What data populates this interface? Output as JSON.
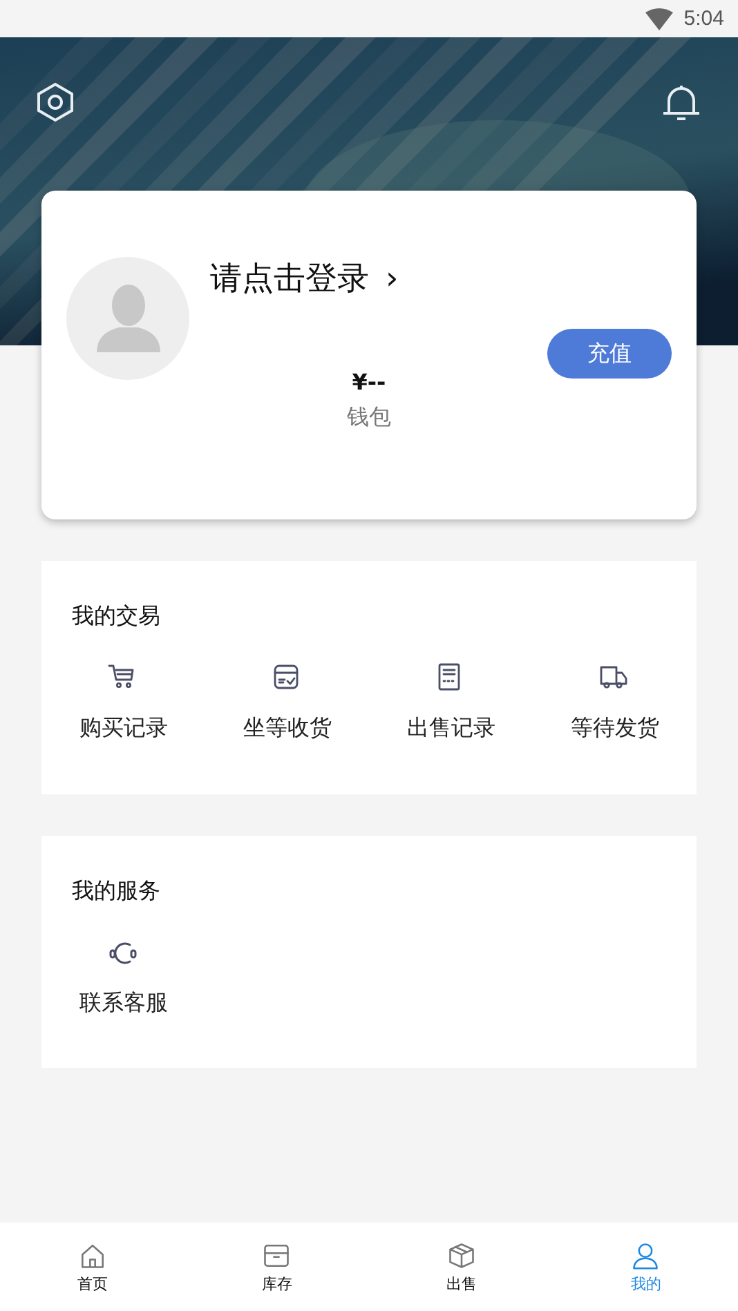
{
  "status_bar": {
    "time": "5:04"
  },
  "profile": {
    "login_prompt": "请点击登录",
    "chevron": "›",
    "recharge_button": "充值",
    "balance": "¥--",
    "balance_label": "钱包"
  },
  "trade_section": {
    "title": "我的交易",
    "items": [
      {
        "label": "购买记录"
      },
      {
        "label": "坐等收货"
      },
      {
        "label": "出售记录"
      },
      {
        "label": "等待发货"
      }
    ]
  },
  "service_section": {
    "title": "我的服务",
    "items": [
      {
        "label": "联系客服"
      }
    ]
  },
  "tab_bar": [
    {
      "label": "首页",
      "selected": false
    },
    {
      "label": "库存",
      "selected": false
    },
    {
      "label": "出售",
      "selected": false
    },
    {
      "label": "我的",
      "selected": true
    }
  ]
}
